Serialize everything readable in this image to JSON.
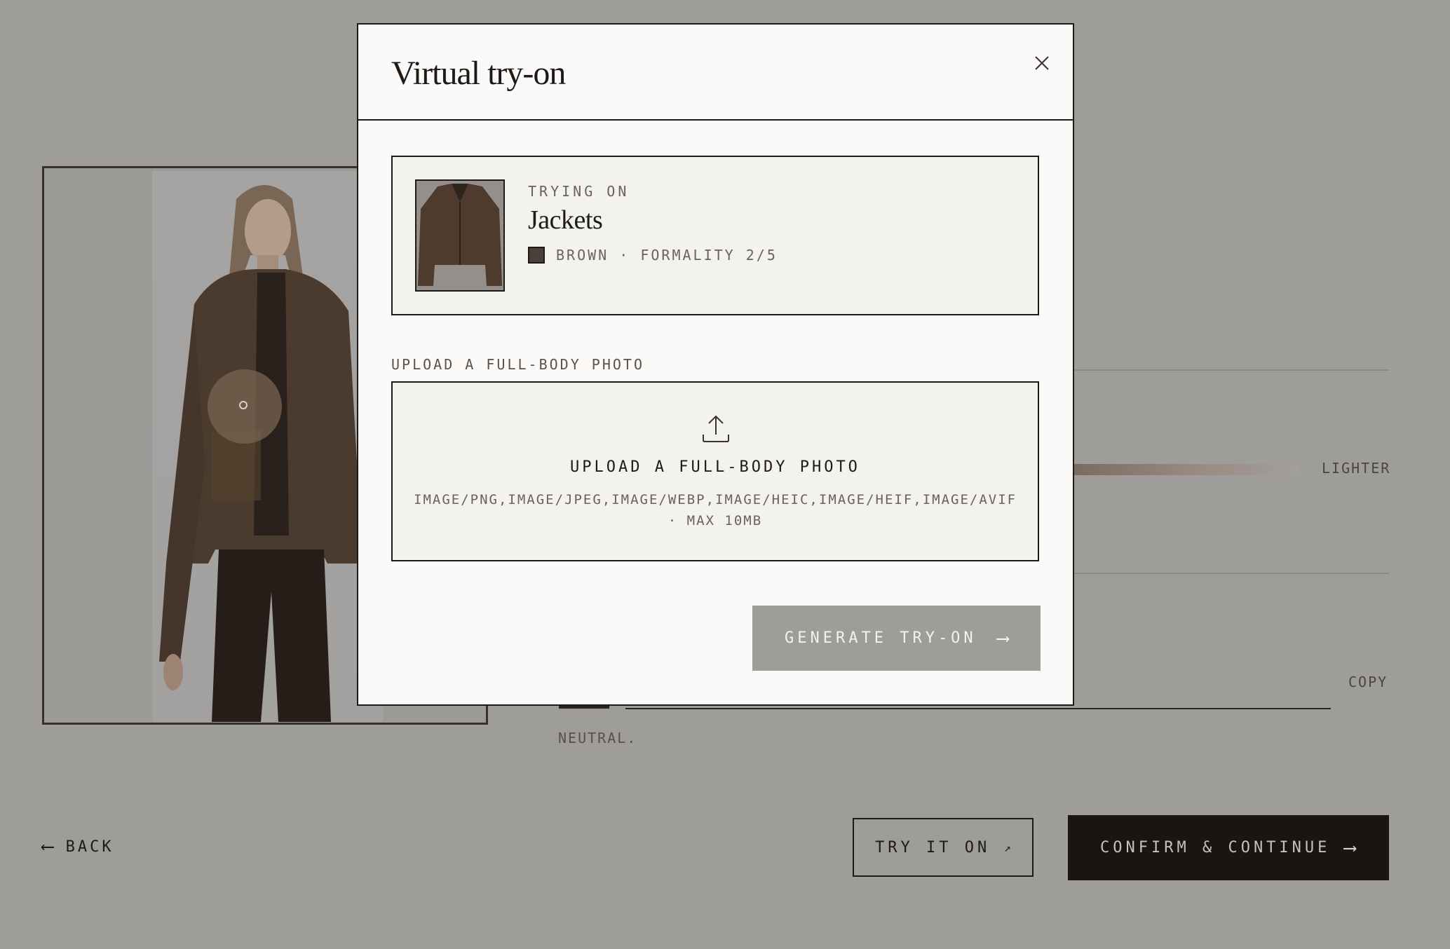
{
  "background": {
    "slider": {
      "right_label": "LIGHTER"
    },
    "copy_label": "COPY",
    "tone_caption": "NEUTRAL.",
    "footer": {
      "back_label": "BACK",
      "try_on_label": "TRY IT ON",
      "confirm_label": "CONFIRM & CONTINUE"
    }
  },
  "modal": {
    "title": "Virtual try-on",
    "item": {
      "eyebrow": "TRYING ON",
      "name": "Jackets",
      "color_swatch": "#4a3f39",
      "meta": "BROWN · FORMALITY 2/5"
    },
    "upload": {
      "section_label": "UPLOAD A FULL-BODY PHOTO",
      "dropzone_title": "UPLOAD A FULL-BODY PHOTO",
      "accepted_types": "IMAGE/PNG,IMAGE/JPEG,IMAGE/WEBP,IMAGE/HEIC,IMAGE/HEIF,IMAGE/AVIF",
      "max_size": "· MAX 10MB"
    },
    "generate_label": "GENERATE TRY-ON"
  },
  "icons": {
    "back": "arrow-left-icon",
    "try_on": "arrow-up-right-icon",
    "confirm": "arrow-right-icon",
    "close": "close-icon",
    "upload": "upload-icon",
    "generate": "arrow-right-icon"
  },
  "colors": {
    "overlay_bg": "#9e9d99",
    "modal_bg": "#fbfaf8",
    "card_bg": "#f3f2ee",
    "ink": "#1e1a18",
    "confirm_bg": "#1a1512",
    "disabled_button": "#9e9d99"
  }
}
